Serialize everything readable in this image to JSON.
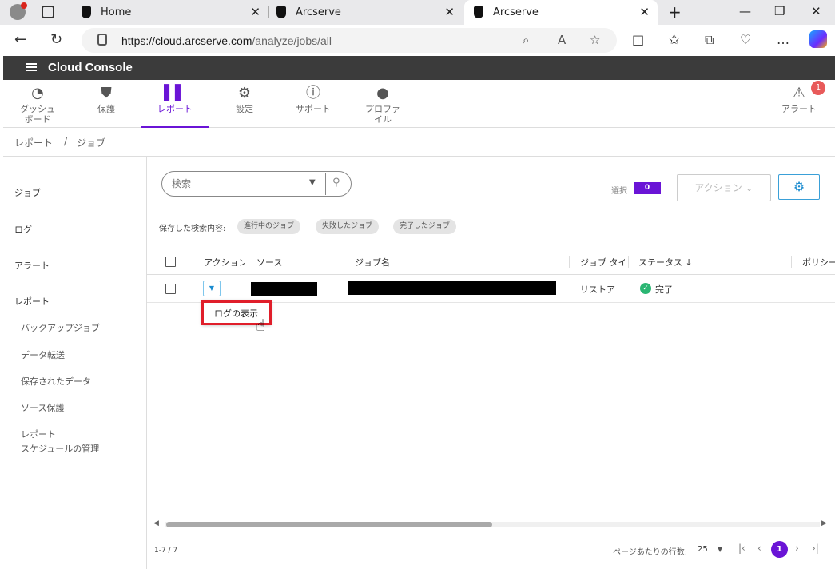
{
  "browser": {
    "tabs": [
      {
        "title": "Home"
      },
      {
        "title": "Arcserve"
      },
      {
        "title": "Arcserve"
      }
    ],
    "url_host": "https://cloud.arcserve.com",
    "url_path": "/analyze/jobs/all"
  },
  "app": {
    "title": "Cloud Console"
  },
  "nav": {
    "items": [
      {
        "label": "ダッシュ\nボード",
        "icon": "gauge-icon"
      },
      {
        "label": "保護",
        "icon": "shield-icon"
      },
      {
        "label": "レポート",
        "icon": "bar-chart-icon"
      },
      {
        "label": "設定",
        "icon": "gear-icon"
      },
      {
        "label": "サポート",
        "icon": "help-icon"
      },
      {
        "label": "プロファ\nイル",
        "icon": "person-icon"
      }
    ],
    "alerts_label": "アラート",
    "alerts_count": "1"
  },
  "breadcrumb": {
    "root": "レポート",
    "sep": "/",
    "current": "ジョブ"
  },
  "sidebar": {
    "items": [
      "ジョブ",
      "ログ",
      "アラート",
      "レポート"
    ],
    "report_subitems": [
      "バックアップジョブ",
      "データ転送",
      "保存されたデータ",
      "ソース保護",
      "レポート",
      "スケジュールの管理"
    ]
  },
  "toolbar": {
    "search_placeholder": "検索",
    "selected_label": "選択",
    "selected_count": "0",
    "action_label": "アクション"
  },
  "saved_searches": {
    "label": "保存した検索内容:",
    "chips": [
      "進行中のジョブ",
      "失敗したジョブ",
      "完了したジョブ"
    ]
  },
  "table": {
    "headers": [
      "アクション",
      "ソース",
      "ジョブ名",
      "ジョブ タイ",
      "ステータス ↓",
      "ポリシー"
    ],
    "rows": [
      {
        "job_type": "リストア",
        "status": "完了"
      }
    ]
  },
  "action_menu": {
    "item": "ログの表示"
  },
  "pager": {
    "count": "1-7 / 7",
    "rows_per_page_label": "ページあたりの行数:",
    "rows_per_page": "25",
    "current_page": "1"
  },
  "colors": {
    "accent": "#6a14d6",
    "header_bg": "#3b3b3b",
    "highlight": "#e01e2a"
  }
}
